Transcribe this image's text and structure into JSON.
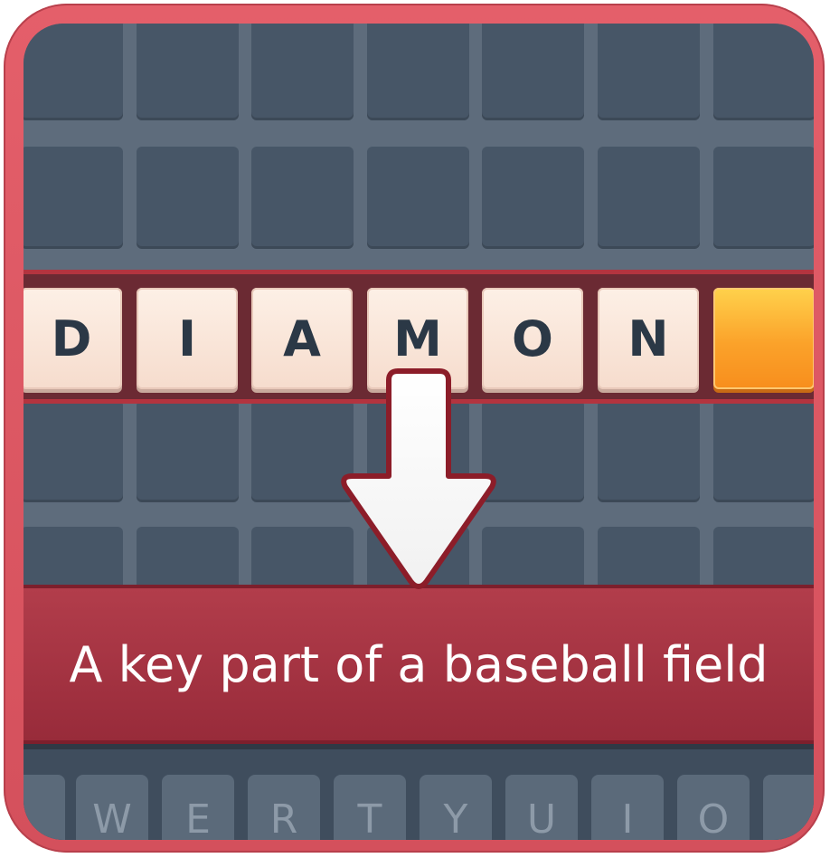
{
  "game": {
    "word_tiles": [
      "D",
      "I",
      "A",
      "M",
      "O",
      "N",
      ""
    ],
    "clue": "A key part of a baseball field",
    "keyboard_keys": [
      "",
      "W",
      "E",
      "R",
      "T",
      "Y",
      "U",
      "I",
      "O",
      ""
    ]
  },
  "colors": {
    "frame": "#e45f6a",
    "board": "#5e6c7c",
    "cell": "#475667",
    "tile": "#fdf0e6",
    "active_tile": "#fba22a",
    "banner": "#a93545",
    "letter": "#2b3846"
  },
  "icons": {
    "arrow": "arrow-down-icon"
  }
}
